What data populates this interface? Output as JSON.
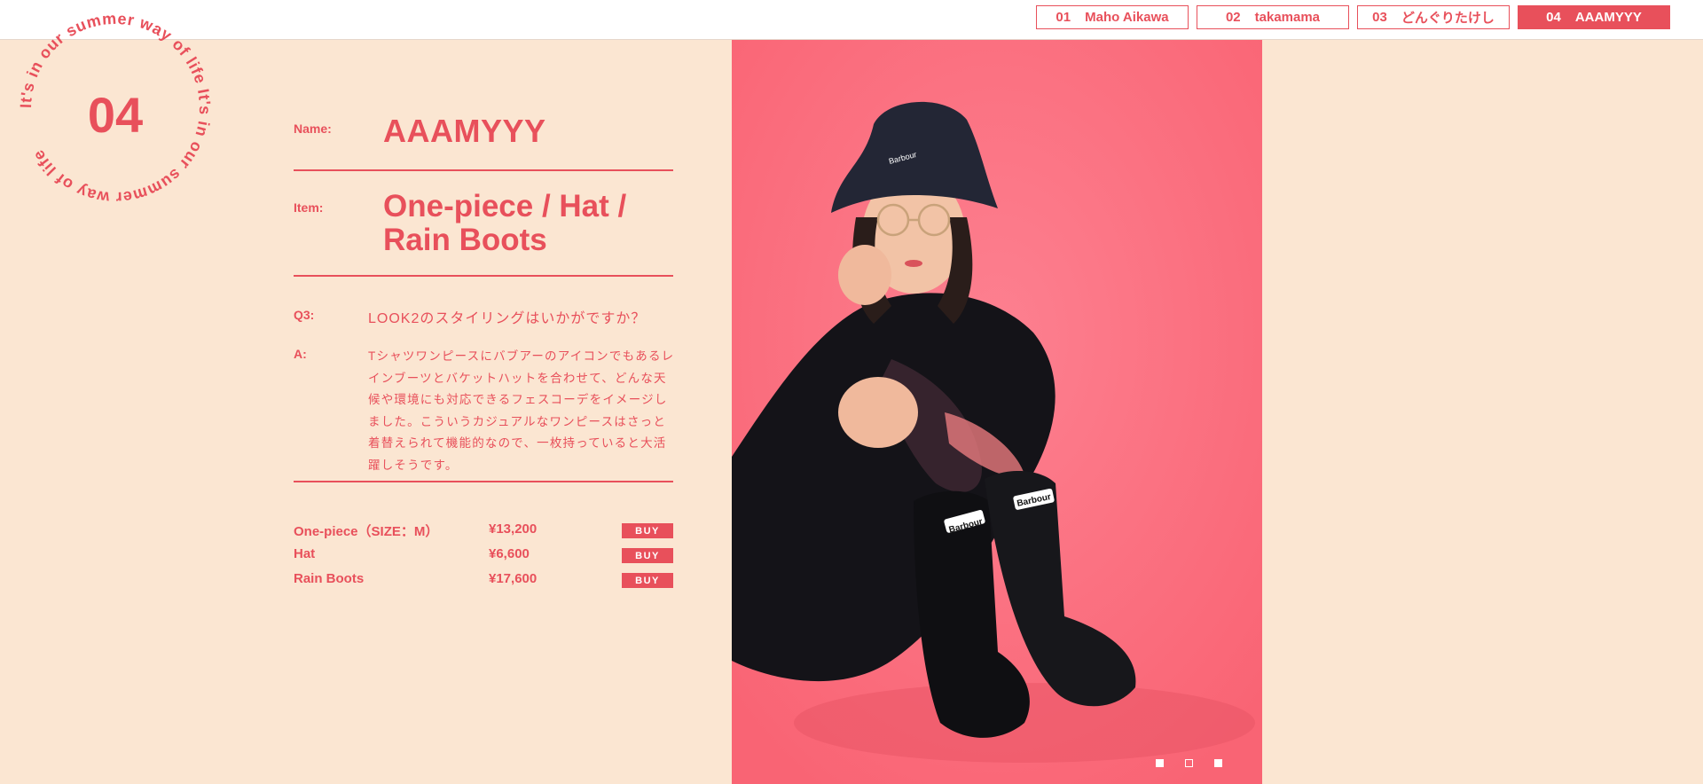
{
  "nav": {
    "tabs": [
      {
        "num": "01",
        "label": "Maho Aikawa"
      },
      {
        "num": "02",
        "label": "takamama"
      },
      {
        "num": "03",
        "label": "どんぐりたけし"
      },
      {
        "num": "04",
        "label": "AAAMYYY"
      }
    ],
    "active_index": 3
  },
  "seal": {
    "number": "04",
    "ring_text": "It's in our summer way of life It's in our summer way of life "
  },
  "profile": {
    "name_label": "Name:",
    "name": "AAAMYYY",
    "item_label": "Item:",
    "item_line1": "One-piece / Hat /",
    "item_line2": "Rain Boots"
  },
  "qa": {
    "q_label": "Q3:",
    "question": "LOOK2のスタイリングはいかがですか？",
    "a_label": "A:",
    "answer": "Tシャツワンピースにバブアーのアイコンでもあるレインブーツとバケットハットを合わせて、どんな天候や環境にも対応できるフェスコーデをイメージしました。こういうカジュアルなワンピースはさっと着替えられて機能的なので、一枚持っていると大活躍しそうです。"
  },
  "products": [
    {
      "name": "One-piece（SIZE：M）",
      "price": "¥13,200",
      "buy": "BUY"
    },
    {
      "name": "Hat",
      "price": "¥6,600",
      "buy": "BUY"
    },
    {
      "name": "Rain Boots",
      "price": "¥17,600",
      "buy": "BUY"
    }
  ],
  "photo": {
    "hat_logo": "Barbour",
    "boot_logo": "Barbour",
    "slide_count": 3,
    "active_slide": 0
  },
  "colors": {
    "accent": "#e8505b",
    "page_bg": "#fbe6d2",
    "photo_bg": "#fb6f80"
  }
}
